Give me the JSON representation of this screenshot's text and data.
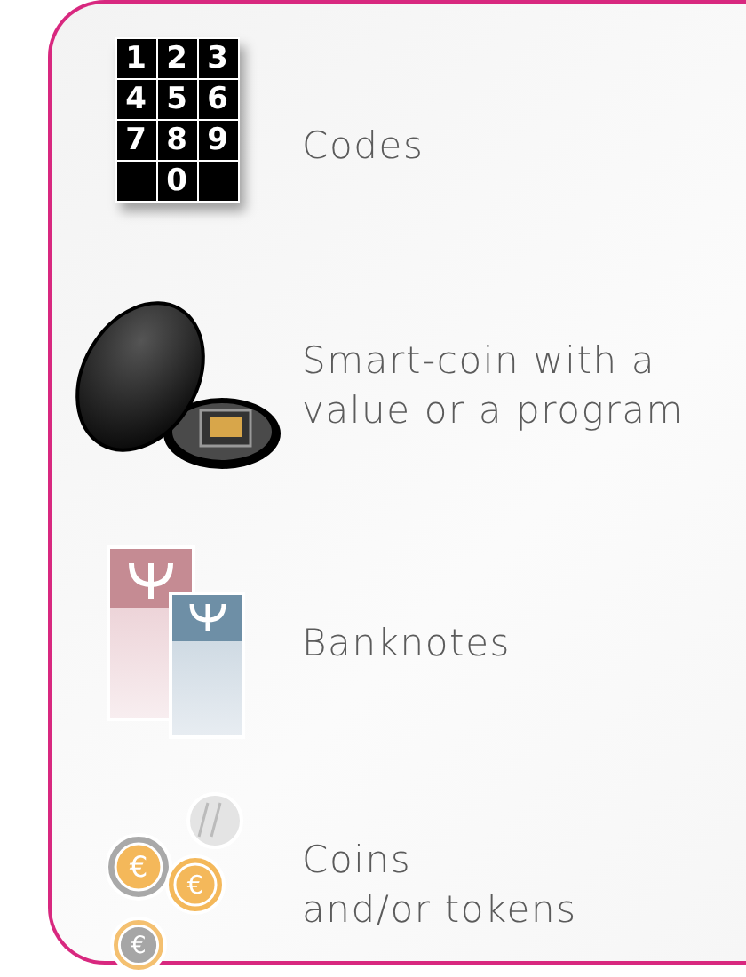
{
  "items": [
    {
      "kind": "keypad",
      "lines": [
        "Codes"
      ],
      "keys": [
        "1",
        "2",
        "3",
        "4",
        "5",
        "6",
        "7",
        "8",
        "9",
        "0"
      ]
    },
    {
      "kind": "smart-coin",
      "lines": [
        "Smart-coin with a",
        "value or a program"
      ]
    },
    {
      "kind": "banknotes",
      "lines": [
        "Banknotes"
      ]
    },
    {
      "kind": "coins",
      "lines": [
        "Coins",
        "and/or tokens"
      ],
      "symbols": [
        "€",
        "€",
        "€"
      ]
    }
  ]
}
